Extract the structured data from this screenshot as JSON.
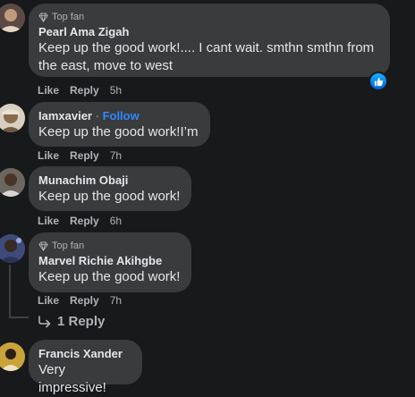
{
  "comments": [
    {
      "badge": "Top fan",
      "author": "Pearl Ama Zigah",
      "text_line1": "Keep up the good work!.... I cant wait. smthn smthn from",
      "text_line2": "the east, move to west",
      "like": "Like",
      "reply": "Reply",
      "time": "5h"
    },
    {
      "author": "Iamxavier",
      "follow_sep": " · ",
      "follow": "Follow",
      "text": "Keep up the good work!I’m",
      "like": "Like",
      "reply": "Reply",
      "time": "7h"
    },
    {
      "author": "Munachim Obaji",
      "text": "Keep up the good work!",
      "like": "Like",
      "reply": "Reply",
      "time": "6h"
    },
    {
      "badge": "Top fan",
      "author": "Marvel Richie Akihgbe",
      "text": "Keep up the good work!",
      "like": "Like",
      "reply": "Reply",
      "time": "7h"
    },
    {
      "author": "Francis Xander",
      "text": "Very impressive!"
    }
  ],
  "replies_link": "1 Reply",
  "colors": {
    "background": "#18191a",
    "bubble": "#3a3b3c",
    "text": "#e4e6eb",
    "muted": "#b0b3b8",
    "link": "#2d88ff"
  }
}
